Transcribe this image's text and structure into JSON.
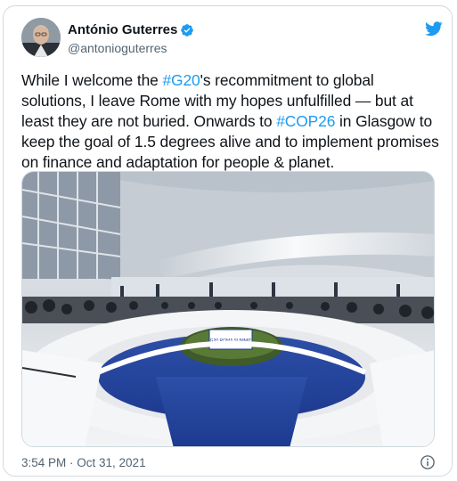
{
  "author": {
    "display_name": "António Guterres",
    "handle": "@antonioguterres",
    "avatar_icon": "avatar-photo",
    "verified_icon": "verified-badge-icon"
  },
  "tweet": {
    "text_parts": [
      {
        "type": "text",
        "value": "While I welcome the "
      },
      {
        "type": "hashtag",
        "value": "#G20"
      },
      {
        "type": "text",
        "value": "'s recommitment to global solutions, I leave Rome with my hopes unfulfilled — but at least they are not buried. Onwards to "
      },
      {
        "type": "hashtag",
        "value": "#COP26"
      },
      {
        "type": "text",
        "value": " in Glasgow to keep the goal of 1.5 degrees alive and to implement promises on finance and adaptation for people & planet."
      }
    ]
  },
  "media": {
    "sign_text": "G20 ROMA SUMMIT"
  },
  "meta": {
    "timestamp": "3:54 PM · Oct 31, 2021"
  },
  "colors": {
    "accent": "#1d9bf0",
    "text": "#0f1419",
    "muted": "#536471",
    "border": "#cfd9de"
  }
}
